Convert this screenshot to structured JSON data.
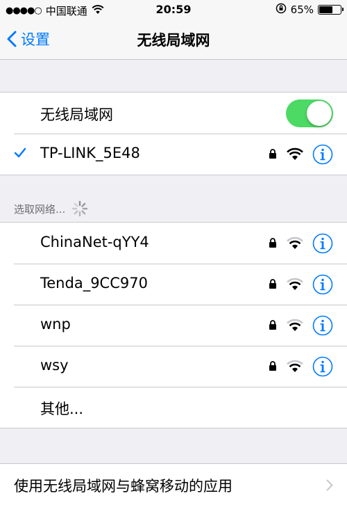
{
  "status_bar": {
    "signal_dots": "●●●●○",
    "carrier": "中国联通",
    "time": "20:59",
    "battery_percent": "65%",
    "battery_level": 0.65
  },
  "nav": {
    "back_label": "设置",
    "title": "无线局域网"
  },
  "wifi_toggle": {
    "label": "无线局域网",
    "on": true,
    "on_color": "#4cd964"
  },
  "connected_network": {
    "name": "TP-LINK_5E48",
    "check_icon": "checkmark-icon"
  },
  "choose_section": {
    "header": "选取网络..."
  },
  "networks": [
    {
      "name": "ChinaNet-qYY4"
    },
    {
      "name": "Tenda_9CC970"
    },
    {
      "name": "wnp"
    },
    {
      "name": "wsy"
    }
  ],
  "other_label": "其他...",
  "cellular_apps_label": "使用无线局域网与蜂窝移动的应用",
  "accent_color": "#007aff"
}
